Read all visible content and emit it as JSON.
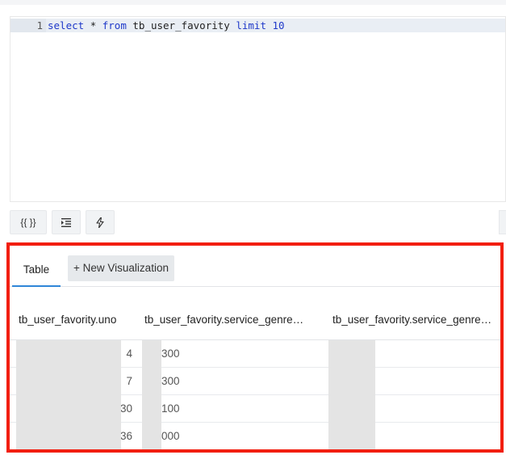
{
  "editor": {
    "line_number": "1",
    "tokens": {
      "select": "select",
      "star": "*",
      "from": "from",
      "table": "tb_user_favority",
      "limit": "limit",
      "limit_value": "10"
    }
  },
  "toolbar": {
    "format_label": "{{ }}",
    "indent_icon": "indent-icon",
    "execute_icon": "lightning-icon"
  },
  "results": {
    "tabs": {
      "table": "Table",
      "new_visualization": "+ New Visualization"
    },
    "columns": [
      "tb_user_favority.uno",
      "tb_user_favority.service_genre…",
      "tb_user_favority.service_genre…"
    ],
    "rows": [
      {
        "uno_tail": "4",
        "genre_tail": "300"
      },
      {
        "uno_tail": "7",
        "genre_tail": "300"
      },
      {
        "uno_tail": "30",
        "genre_tail": "100"
      },
      {
        "uno_tail": "36",
        "genre_tail": "000"
      }
    ]
  },
  "colors": {
    "highlight_border": "#f21e10",
    "active_tab_underline": "#2f86d8",
    "keyword": "#1f39c9"
  }
}
